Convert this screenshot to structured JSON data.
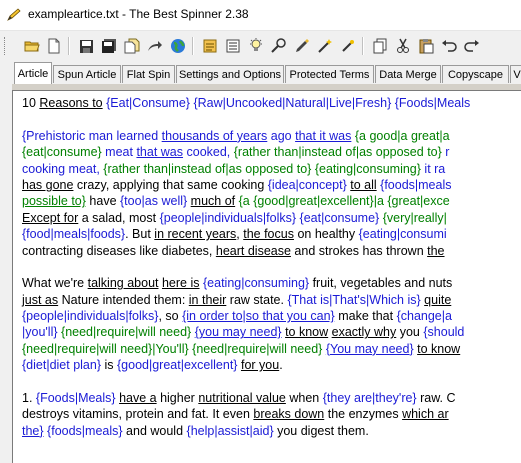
{
  "window": {
    "title": "exampleartice.txt - The Best Spinner 2.38"
  },
  "toolbar": {
    "icons": [
      "open-folder-icon",
      "new-document-icon",
      "save-icon",
      "save-all-icon",
      "copy-document-icon",
      "share-arrow-icon",
      "globe-icon",
      "notes-icon",
      "list-icon",
      "bulb-icon",
      "search-wand-icon",
      "brush-icon",
      "magic-wand-icon",
      "wand-icon",
      "copy-icon",
      "cut-icon",
      "paste-icon",
      "undo-icon",
      "redo-icon"
    ]
  },
  "tabs": [
    {
      "label": "Article"
    },
    {
      "label": "Spun Article"
    },
    {
      "label": "Flat Spin"
    },
    {
      "label": "Settings and Options"
    },
    {
      "label": "Protected Terms"
    },
    {
      "label": "Data Merge"
    },
    {
      "label": "Copyscape"
    },
    {
      "label": "V"
    }
  ],
  "article": {
    "l1": [
      "10 ",
      "Reasons to",
      " ",
      "{Eat|Consume}",
      " ",
      "{Raw|Uncooked|Natural|Live|Fresh}",
      " ",
      "{Foods|Meals"
    ],
    "p1l1": [
      "{Prehistoric man learned ",
      "thousands of years",
      " ago ",
      "that it was",
      " ",
      "{a good|a great|a"
    ],
    "p1l2": [
      "{eat|consume}",
      " meat ",
      "that was",
      " cooked, ",
      "{rather than|instead of|as opposed to}",
      " r"
    ],
    "p1l3": [
      "cooking meat, ",
      "{rather than|instead of|as opposed to}",
      " ",
      "{eating|consuming}",
      " it ra"
    ],
    "p1l4": [
      "has gone",
      " crazy, applying that same cooking ",
      "{idea|concept}",
      " ",
      "to all",
      " ",
      "{foods|meals"
    ],
    "p1l5": [
      "possible to}",
      " have ",
      "{too|as well}",
      " ",
      "much of",
      " ",
      "{a {good|great|excellent}|a {great|exce"
    ],
    "p1l6": [
      "Except for",
      " a salad, most ",
      "{people|individuals|folks}",
      " ",
      "{eat|consume}",
      " ",
      "{very|really|"
    ],
    "p1l7": [
      "{food|meals|foods}",
      ". But ",
      "in recent years",
      ", ",
      "the focus",
      " on healthy ",
      "{eating|consumi"
    ],
    "p1l8": [
      "contracting diseases like diabetes, ",
      "heart disease",
      " and strokes has thrown ",
      "the"
    ],
    "p2l1": [
      "What we're ",
      "talking about",
      " ",
      "here is",
      " ",
      "{eating|consuming}",
      " fruit, vegetables and nuts"
    ],
    "p2l2": [
      "just as",
      " Nature intended them: ",
      "in their",
      " raw state. ",
      "{That is|That's|Which is}",
      " ",
      "quite"
    ],
    "p2l3": [
      "{people|individuals|folks}",
      ", so ",
      "{in order to|so that you can}",
      " make that ",
      "{change|a"
    ],
    "p2l4": [
      "|you'll}",
      " ",
      "{need|require|will need}",
      " ",
      "{you may need}",
      " ",
      "to know",
      " ",
      "exactly why",
      " you ",
      "{should"
    ],
    "p2l5": [
      "{need|require|will need}",
      "|You'll} ",
      "{need|require|will need}",
      " ",
      "{You may need}",
      " ",
      "to know"
    ],
    "p2l6": [
      "{diet|diet plan}",
      " is ",
      "{good|great|excellent}",
      " ",
      "for you",
      "."
    ],
    "p3l1": [
      "1. ",
      "{Foods|Meals}",
      " ",
      "have a",
      " higher ",
      "nutritional value",
      " when ",
      "{they are|they're}",
      " raw. C"
    ],
    "p3l2": [
      "destroys vitamins, protein and fat.  It even ",
      "breaks down",
      " the enzymes ",
      "which ar"
    ],
    "p3l3": [
      "the}",
      " ",
      "{foods|meals}",
      " and would ",
      "{help|assist|aid}",
      " you digest them."
    ]
  }
}
